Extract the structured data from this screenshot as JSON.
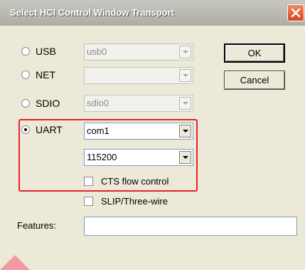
{
  "window": {
    "title": "Select HCI Control Window Transport"
  },
  "transports": [
    {
      "label": "USB",
      "value": "usb0",
      "checked": false,
      "enabled": false
    },
    {
      "label": "NET",
      "value": "",
      "checked": false,
      "enabled": false
    },
    {
      "label": "SDIO",
      "value": "sdio0",
      "checked": false,
      "enabled": false
    },
    {
      "label": "UART",
      "value": "com1",
      "checked": true,
      "enabled": true
    }
  ],
  "uart": {
    "baud_rate": "115200",
    "cts_label": "CTS flow control",
    "cts_checked": false
  },
  "slip": {
    "label": "SLIP/Three-wire",
    "checked": false
  },
  "features": {
    "label": "Features:",
    "value": ""
  },
  "buttons": {
    "ok": "OK",
    "cancel": "Cancel"
  },
  "colors": {
    "highlight": "#e8232a",
    "close": "#d7451d"
  },
  "icons": {
    "close": "close-icon",
    "dropdown": "chevron-down-icon"
  }
}
